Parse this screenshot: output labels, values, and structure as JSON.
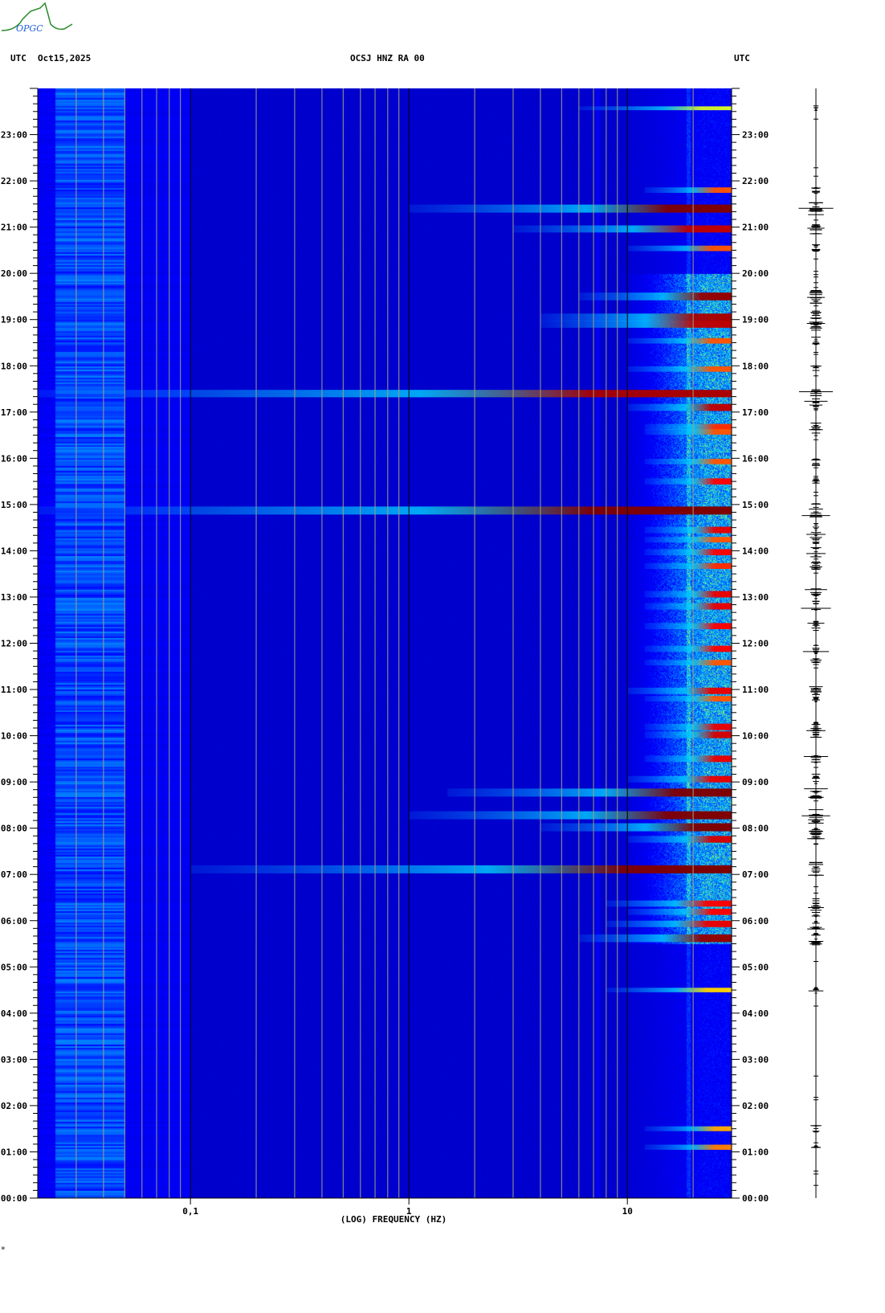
{
  "logo": {
    "text": "OPGC"
  },
  "header": {
    "left_tz": "UTC",
    "date": "Oct15,2025",
    "station": "OCSJ HNZ RA 00",
    "right_tz": "UTC"
  },
  "corner_mark": "ᴍ",
  "chart_data": {
    "type": "heatmap",
    "title": "OCSJ HNZ RA 00",
    "subtitle": "Oct15,2025",
    "xlabel": "(LOG) FREQUENCY (HZ)",
    "ylabel": "UTC",
    "x_scale": "log",
    "xlim": [
      0.02,
      30
    ],
    "x_ticks": [
      {
        "value": 0.1,
        "label": "0,1"
      },
      {
        "value": 1,
        "label": "1"
      },
      {
        "value": 10,
        "label": "10"
      }
    ],
    "grid_frequencies": [
      0.03,
      0.04,
      0.05,
      0.06,
      0.07,
      0.08,
      0.09,
      0.2,
      0.3,
      0.4,
      0.5,
      0.6,
      0.7,
      0.8,
      0.9,
      2,
      3,
      4,
      5,
      6,
      7,
      8,
      9,
      20,
      30
    ],
    "ylim_hours": [
      0,
      24
    ],
    "y_ticks": [
      "00:00",
      "01:00",
      "02:00",
      "03:00",
      "04:00",
      "05:00",
      "06:00",
      "07:00",
      "08:00",
      "09:00",
      "10:00",
      "11:00",
      "12:00",
      "13:00",
      "14:00",
      "15:00",
      "16:00",
      "17:00",
      "18:00",
      "19:00",
      "20:00",
      "21:00",
      "22:00",
      "23:00"
    ],
    "minor_tick_minutes": 10,
    "colormap": [
      "#000080",
      "#0000ff",
      "#00c8ff",
      "#ffff00",
      "#ff0000",
      "#800000"
    ],
    "events": [
      {
        "t": 23.57,
        "i": 0.35,
        "f0": 6
      },
      {
        "t": 21.8,
        "i": 0.6,
        "f0": 12
      },
      {
        "t": 21.4,
        "i": 1.0,
        "f0": 1
      },
      {
        "t": 20.96,
        "i": 0.85,
        "f0": 3
      },
      {
        "t": 20.54,
        "i": 0.6,
        "f0": 10
      },
      {
        "t": 19.5,
        "i": 0.95,
        "f0": 6
      },
      {
        "t": 19.05,
        "i": 0.9,
        "f0": 4
      },
      {
        "t": 18.9,
        "i": 0.85,
        "f0": 4
      },
      {
        "t": 18.54,
        "i": 0.6,
        "f0": 10
      },
      {
        "t": 17.93,
        "i": 0.6,
        "f0": 10
      },
      {
        "t": 17.4,
        "i": 0.9,
        "f0": 0.02
      },
      {
        "t": 17.1,
        "i": 0.85,
        "f0": 10
      },
      {
        "t": 16.68,
        "i": 0.65,
        "f0": 12
      },
      {
        "t": 16.57,
        "i": 0.6,
        "f0": 12
      },
      {
        "t": 15.93,
        "i": 0.6,
        "f0": 12
      },
      {
        "t": 15.5,
        "i": 0.7,
        "f0": 12
      },
      {
        "t": 14.87,
        "i": 1.0,
        "f0": 0.02
      },
      {
        "t": 14.45,
        "i": 0.75,
        "f0": 12
      },
      {
        "t": 14.24,
        "i": 0.6,
        "f0": 12
      },
      {
        "t": 13.97,
        "i": 0.7,
        "f0": 12
      },
      {
        "t": 13.67,
        "i": 0.65,
        "f0": 12
      },
      {
        "t": 13.06,
        "i": 0.75,
        "f0": 12
      },
      {
        "t": 12.8,
        "i": 0.75,
        "f0": 12
      },
      {
        "t": 12.37,
        "i": 0.7,
        "f0": 12
      },
      {
        "t": 11.88,
        "i": 0.7,
        "f0": 12
      },
      {
        "t": 11.58,
        "i": 0.6,
        "f0": 12
      },
      {
        "t": 10.97,
        "i": 0.75,
        "f0": 10
      },
      {
        "t": 10.8,
        "i": 0.6,
        "f0": 12
      },
      {
        "t": 10.19,
        "i": 0.75,
        "f0": 12
      },
      {
        "t": 10.02,
        "i": 0.8,
        "f0": 12
      },
      {
        "t": 9.5,
        "i": 0.75,
        "f0": 12
      },
      {
        "t": 9.06,
        "i": 0.75,
        "f0": 10
      },
      {
        "t": 8.77,
        "i": 1.0,
        "f0": 1.5
      },
      {
        "t": 8.28,
        "i": 1.0,
        "f0": 1
      },
      {
        "t": 8.02,
        "i": 1.0,
        "f0": 4
      },
      {
        "t": 7.76,
        "i": 0.8,
        "f0": 10
      },
      {
        "t": 7.11,
        "i": 1.0,
        "f0": 0.1
      },
      {
        "t": 6.37,
        "i": 0.7,
        "f0": 8
      },
      {
        "t": 6.19,
        "i": 0.7,
        "f0": 10
      },
      {
        "t": 5.93,
        "i": 0.75,
        "f0": 8
      },
      {
        "t": 5.62,
        "i": 0.95,
        "f0": 6
      },
      {
        "t": 4.5,
        "i": 0.45,
        "f0": 8
      },
      {
        "t": 1.5,
        "i": 0.5,
        "f0": 12
      },
      {
        "t": 1.1,
        "i": 0.55,
        "f0": 12
      }
    ]
  }
}
